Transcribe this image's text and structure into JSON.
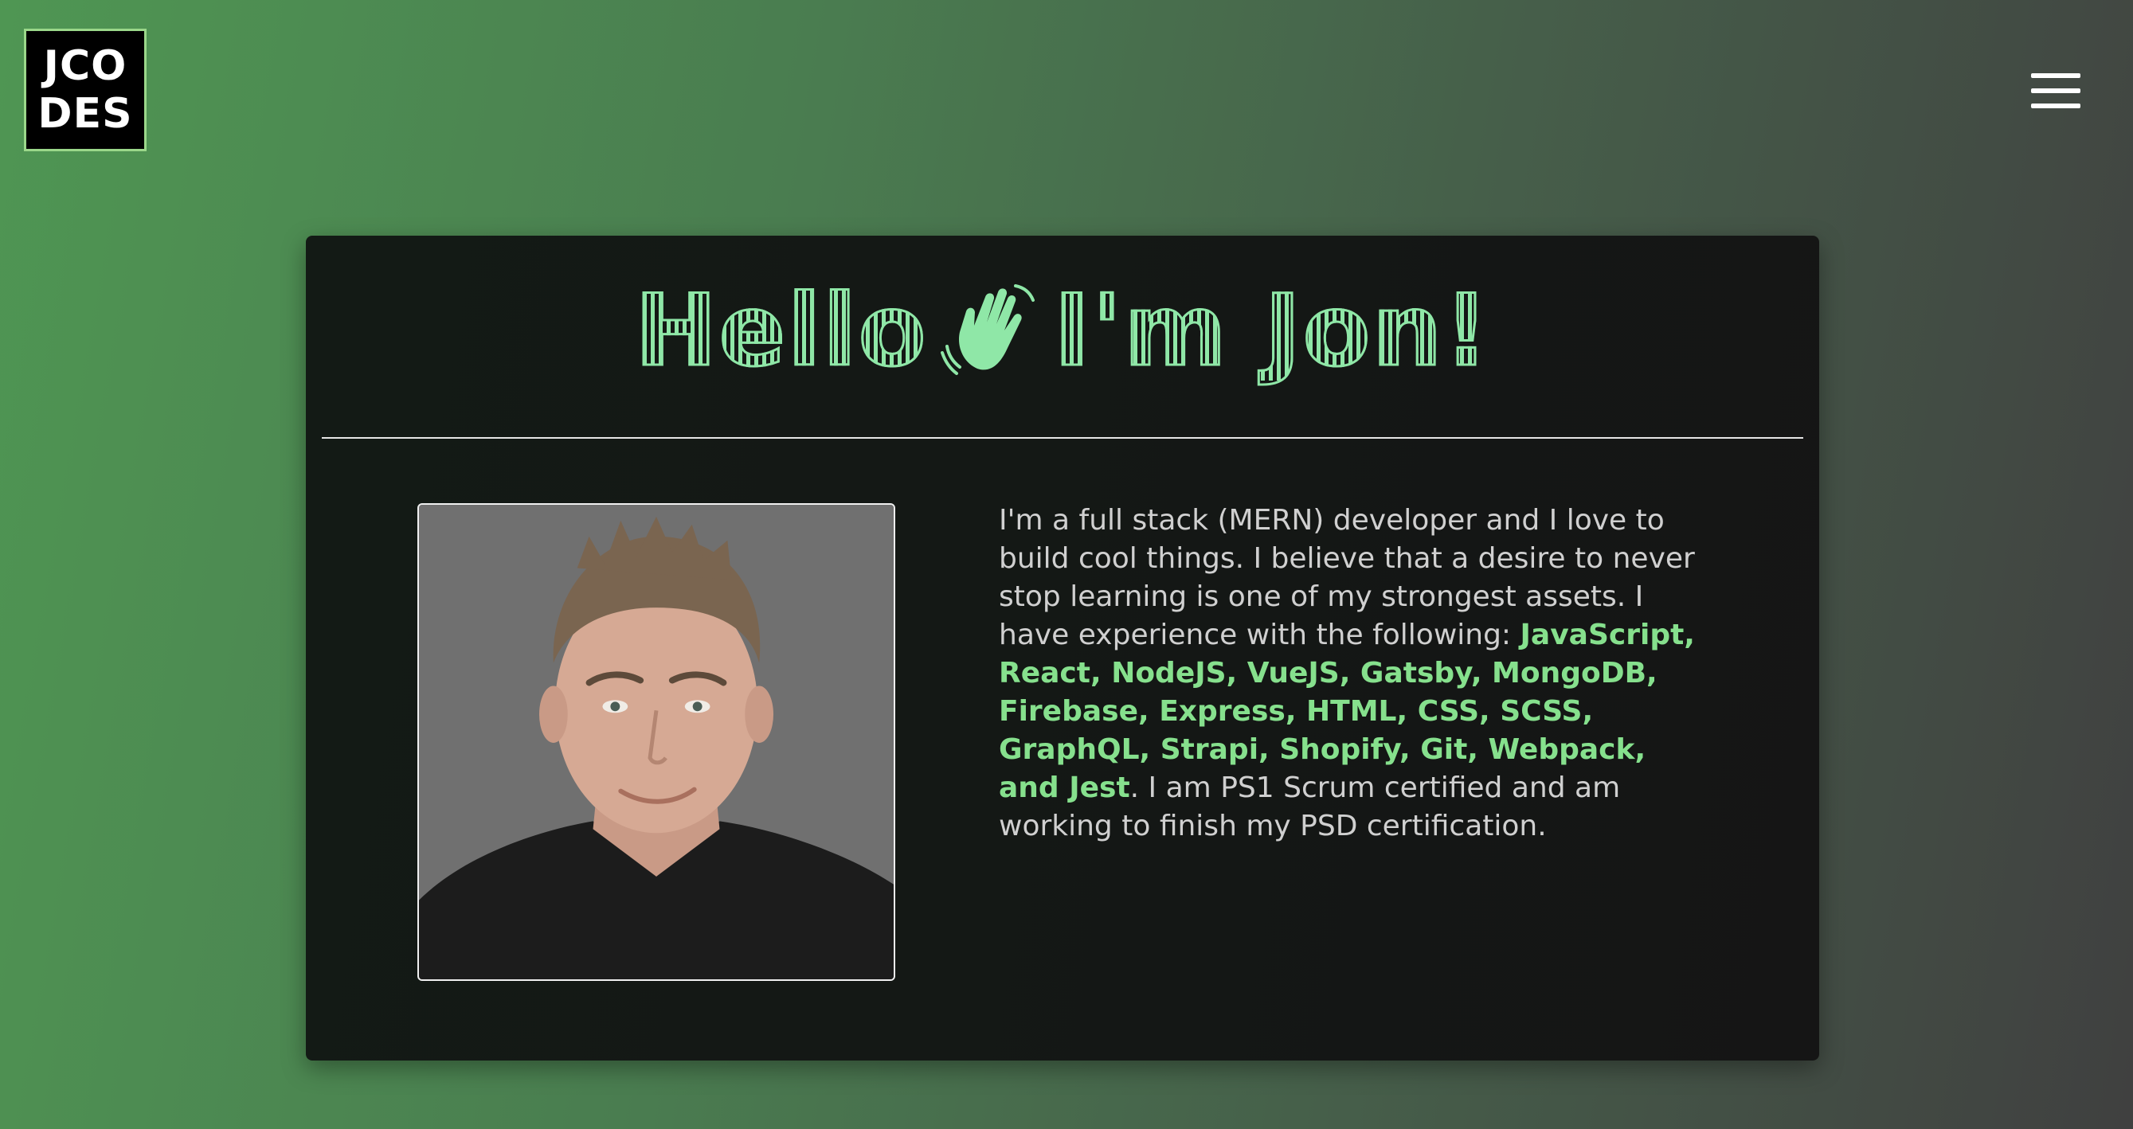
{
  "header": {
    "logo_line1": "JCO",
    "logo_line2": "DES",
    "menu_icon": "hamburger-menu-icon"
  },
  "hero": {
    "greeting_part1": "Hello",
    "greeting_emoji": "waving-hand-icon",
    "greeting_part2": "I'm Jon!",
    "accent_color": "#8fe7a7"
  },
  "about": {
    "photo_alt": "Jon",
    "bio_intro": "I'm a full stack (MERN) developer and I love to build cool things. I believe that a desire to never stop learning is one of my strongest assets. I have experience with the following: ",
    "skills": "JavaScript, React, NodeJS, VueJS, Gatsby, MongoDB, Firebase, Express, HTML, CSS, SCSS, GraphQL, Strapi, Shopify, Git, Webpack, and Jest",
    "bio_outro": ". I am PS1 Scrum certified and am working to finish my PSD certification.",
    "skills_color": "#86e08d"
  }
}
